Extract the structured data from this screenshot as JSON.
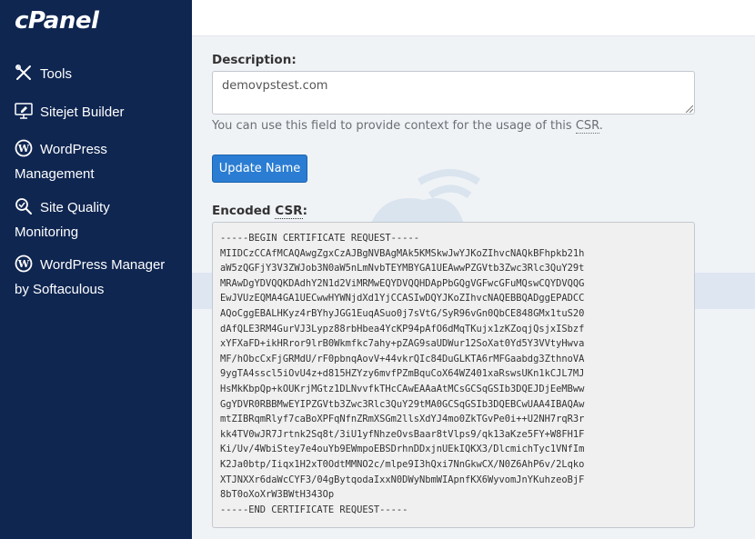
{
  "brand": {
    "logo": "cPanel"
  },
  "sidebar": {
    "items": [
      {
        "label": "Tools",
        "icon": "tools-icon"
      },
      {
        "label": "Sitejet Builder",
        "icon": "monitor-edit-icon"
      },
      {
        "label": "WordPress",
        "label2": "Management",
        "icon": "wordpress-icon"
      },
      {
        "label": "Site Quality",
        "label2": "Monitoring",
        "icon": "magnifier-check-icon"
      },
      {
        "label": "WordPress Manager",
        "label2": "by Softaculous",
        "icon": "wordpress-icon"
      }
    ]
  },
  "form": {
    "description_label": "Description:",
    "description_value": "demovpstest.com",
    "help_prefix": "You can use this field to provide context for the usage of this ",
    "help_abbr": "CSR",
    "help_suffix": ".",
    "update_button": "Update Name",
    "encoded_label_prefix": "Encoded ",
    "encoded_label_abbr": "CSR",
    "encoded_label_suffix": ":"
  },
  "csr_lines": [
    "-----BEGIN CERTIFICATE REQUEST-----",
    "MIIDCzCCAfMCAQAwgZgxCzAJBgNVBAgMAk5KMSkwJwYJKoZIhvcNAQkBFhpkb21h",
    "aW5zQGFjY3V3ZWJob3N0aW5nLmNvbTEYMBYGA1UEAwwPZGVtb3Zwc3Rlc3QuY29t",
    "MRAwDgYDVQQKDAdhY2N1d2ViMRMwEQYDVQQHDApPbGQgVGFwcGFuMQswCQYDVQQG",
    "EwJVUzEQMA4GA1UECwwHYWNjdXd1YjCCASIwDQYJKoZIhvcNAQEBBQADggEPADCC",
    "AQoCggEBALHKyz4rBYhyJGG1EuqASuo0j7sVtG/SyR96vGn0QbCE848GMx1tuS20",
    "dAfQLE3RM4GurVJ3Lypz88rbHbea4YcKP94pAfO6dMqTKujx1zKZoqjQsjxISbzf",
    "xYFXaFD+ikHRror9lrB0Wkmfkc7ahy+pZAG9saUDWur12SoXat0Yd5Y3VVtyHwva",
    "MF/hObcCxFjGRMdU/rF0pbnqAovV+44vkrQIc84DuGLKTA6rMFGaabdg3ZthnoVA",
    "9ygTA4sscl5iOvU4z+d815HZYzy6mvfPZmBquCoX64WZ401xaRswsUKn1kCJL7MJ",
    "HsMkKbpQp+kOUKrjMGtz1DLNvvfkTHcCAwEAAaAtMCsGCSqGSIb3DQEJDjEeMBww",
    "GgYDVR0RBBMwEYIPZGVtb3Zwc3Rlc3QuY29tMA0GCSqGSIb3DQEBCwUAA4IBAQAw",
    "mtZIBRqmRlyf7caBoXPFqNfnZRmXSGm2llsXdYJ4mo0ZkTGvPe0i++U2NH7rqR3r",
    "kk4TV0wJR7Jrtnk2Sq8t/3iU1yfNhzeOvsBaar8tVlps9/qk13aKze5FY+W8FH1F",
    "Ki/Uv/4WbiStey7e4ouYb9EWmpoEBSDrhnDDxjnUEkIQKX3/DlcmichTyc1VNfIm",
    "K2Ja0btp/Iiqx1H2xT0OdtMMNO2c/mlpe9I3hQxi7NnGkwCX/N0Z6AhP6v/2Lqko",
    "XTJNXXr6daWcCYF3/04gBytqodaIxxN0DWyNbmWIApnfKX6WyvomJnYKuhzeoBjF",
    "8bT0oXoXrW3BWtH343Op",
    "-----END CERTIFICATE REQUEST-----"
  ],
  "colors": {
    "sidebar": "#0f2651",
    "button": "#2a7dd2",
    "background": "#f0f3f6"
  }
}
